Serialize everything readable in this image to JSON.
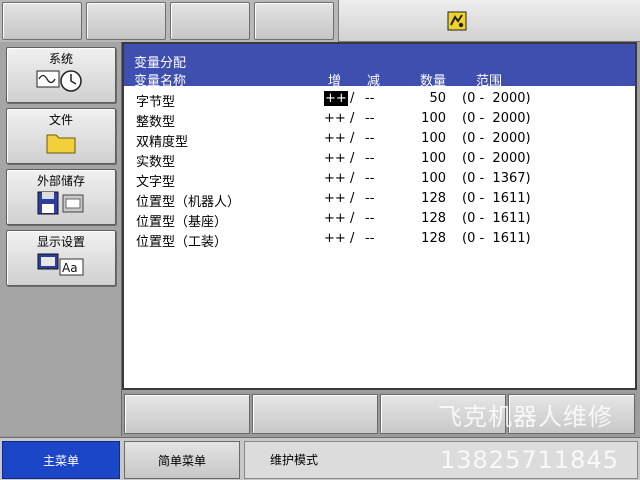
{
  "variable_panel": {
    "title": "变量分配",
    "headers": {
      "name": "变量名称",
      "inc": "增",
      "dec": "减",
      "qty": "数量",
      "range": "范围"
    },
    "rows": [
      {
        "name": "字节型",
        "inc": "++",
        "sep": "/",
        "dec": "--",
        "qty": "50",
        "range": "(0 -  2000)"
      },
      {
        "name": "整数型",
        "inc": "++",
        "sep": "/",
        "dec": "--",
        "qty": "100",
        "range": "(0 -  2000)"
      },
      {
        "name": "双精度型",
        "inc": "++",
        "sep": "/",
        "dec": "--",
        "qty": "100",
        "range": "(0 -  2000)"
      },
      {
        "name": "实数型",
        "inc": "++",
        "sep": "/",
        "dec": "--",
        "qty": "100",
        "range": "(0 -  2000)"
      },
      {
        "name": "文字型",
        "inc": "++",
        "sep": "/",
        "dec": "--",
        "qty": "100",
        "range": "(0 -  1367)"
      },
      {
        "name": "位置型（机器人）",
        "inc": "++",
        "sep": "/",
        "dec": "--",
        "qty": "128",
        "range": "(0 -  1611)"
      },
      {
        "name": "位置型（基座）",
        "inc": "++",
        "sep": "/",
        "dec": "--",
        "qty": "128",
        "range": "(0 -  1611)"
      },
      {
        "name": "位置型（工装）",
        "inc": "++",
        "sep": "/",
        "dec": "--",
        "qty": "128",
        "range": "(0 -  1611)"
      }
    ]
  },
  "side_menu": {
    "system": "系统",
    "file": "文件",
    "external_storage": "外部储存",
    "display_settings": "显示设置"
  },
  "bottom_bar": {
    "main_menu": "主菜单",
    "simple_menu": "简单菜单",
    "mode": "维护模式"
  },
  "watermark": {
    "line1": "飞克机器人维修",
    "line2": "13825711845"
  },
  "icons": {
    "status": "robot-status-icon",
    "system": "waveform-clock-icon",
    "file": "folder-icon",
    "external_storage": "floppy-disk-icon",
    "display_settings": "display-font-icon"
  },
  "colors": {
    "header_blue": "#3f4fb0",
    "main_menu_blue": "#1c46c8",
    "folder_yellow": "#f2d03c",
    "status_icon_yellow": "#f1d32a"
  }
}
